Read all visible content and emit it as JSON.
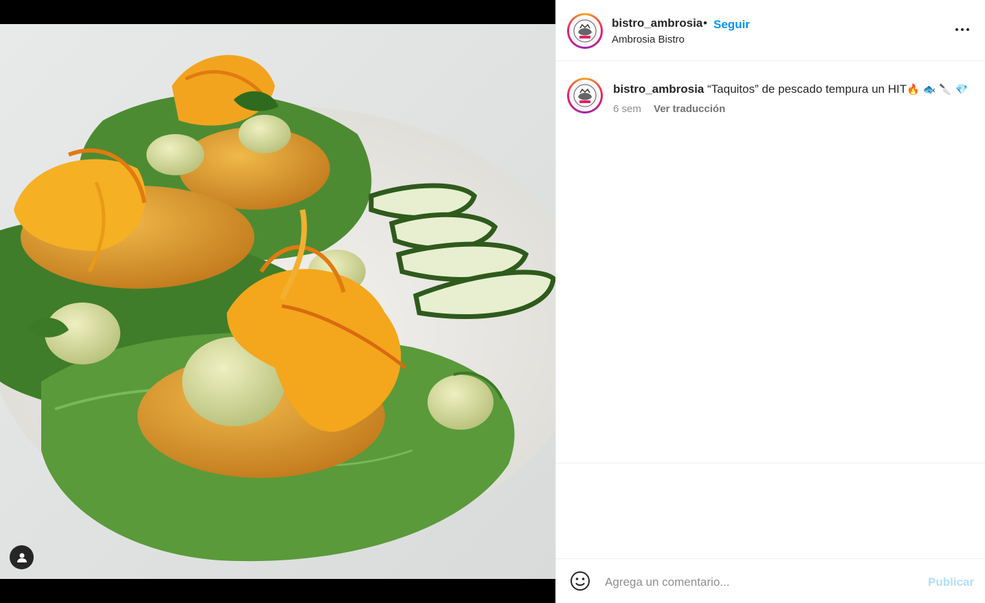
{
  "post": {
    "username": "bistro_ambrosia",
    "separator": "•",
    "follow_label": "Seguir",
    "location": "Ambrosia Bistro",
    "caption_user": "bistro_ambrosia",
    "caption_text": "“Taquitos” de pescado tempura un HIT",
    "caption_emojis": "🔥 🐟 🔪 💎",
    "time_ago": "6 sem",
    "translate_label": "Ver traducción"
  },
  "comment": {
    "placeholder": "Agrega un comentario...",
    "publish_label": "Publicar"
  },
  "icons": {
    "options": "more-options-icon",
    "tag": "user-tag-icon",
    "emoji": "emoji-smiley-icon"
  },
  "colors": {
    "accent": "#0095f6",
    "publish_disabled": "#b2dffc",
    "muted": "#8e8e8e"
  }
}
